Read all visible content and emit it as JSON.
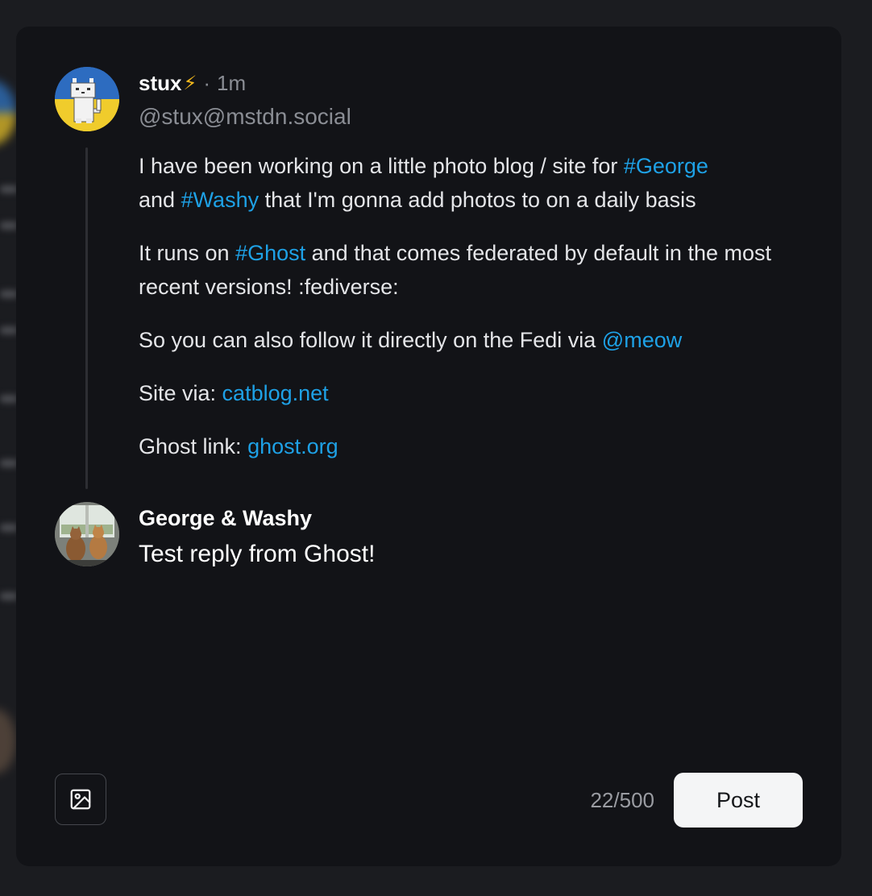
{
  "post": {
    "author_name": "stux",
    "author_badge": "⚡",
    "separator": "·",
    "time": "1m",
    "handle": "@stux@mstdn.social",
    "paragraph1": {
      "t1": "I have been working on a little photo blog / site for ",
      "tag1": "#George",
      "t2": " and ",
      "tag2": "#Washy",
      "t3": " that I'm gonna add photos to on a daily basis"
    },
    "paragraph2": {
      "t1": "It runs on ",
      "tag1": "#Ghost",
      "t2": " and that comes federated by default in the most recent versions! :fediverse:"
    },
    "paragraph3": {
      "t1": "So you can also follow it directly on the Fedi via ",
      "mention": "@meow"
    },
    "paragraph4": {
      "t1": "Site via: ",
      "link": "catblog.net"
    },
    "paragraph5": {
      "t1": "Ghost link: ",
      "link": "ghost.org"
    }
  },
  "reply": {
    "author_name": "George & Washy",
    "text": "Test reply from Ghost!"
  },
  "footer": {
    "image_icon": "image-icon",
    "char_count": "22/500",
    "post_label": "Post"
  },
  "colors": {
    "link": "#1ea1e6",
    "modal_bg": "#121317",
    "page_bg": "#1b1c20",
    "button_bg": "#f4f5f6"
  }
}
